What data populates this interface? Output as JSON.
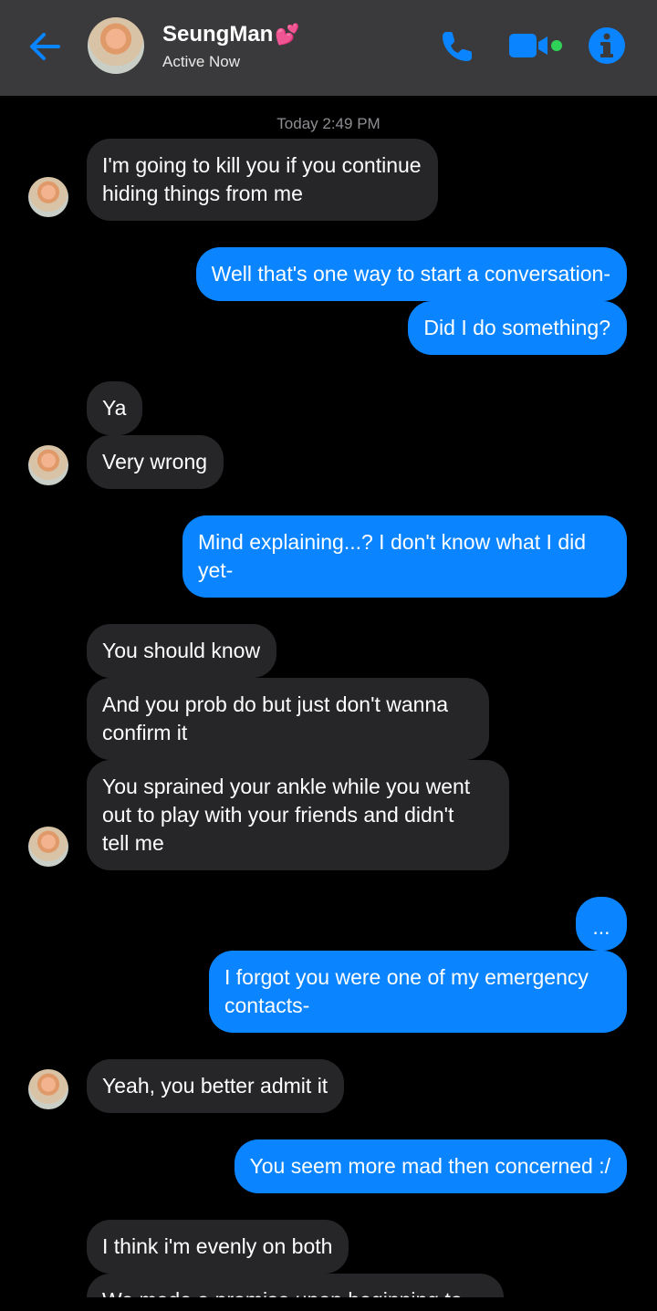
{
  "header": {
    "contact_name": "SeungMan",
    "name_emoji": "💕",
    "status": "Active Now",
    "icons": [
      "back-arrow-icon",
      "phone-icon",
      "video-icon",
      "info-icon"
    ],
    "accent_color": "#0a84ff",
    "online_dot_color": "#30d158"
  },
  "conversation": {
    "timestamp": "Today 2:49 PM",
    "messages": [
      {
        "from": "them",
        "text_lines": [
          "I'm going to kill you if you continue",
          "hiding things from me"
        ]
      },
      {
        "from": "me",
        "text_lines": [
          "Well that's one way to start a conversation-"
        ]
      },
      {
        "from": "me",
        "text_lines": [
          "Did I do something?"
        ]
      },
      {
        "from": "them",
        "text_lines": [
          "Ya"
        ]
      },
      {
        "from": "them",
        "text_lines": [
          "Very wrong"
        ]
      },
      {
        "from": "me",
        "text_lines": [
          "Mind explaining...? I don't know what I did",
          "yet-"
        ]
      },
      {
        "from": "them",
        "text_lines": [
          "You should know"
        ]
      },
      {
        "from": "them",
        "text_lines": [
          "And you prob do but just don't wanna",
          "confirm it"
        ]
      },
      {
        "from": "them",
        "text_lines": [
          "You sprained your ankle while you went",
          "out to play with your friends and didn't",
          "tell me"
        ]
      },
      {
        "from": "me",
        "text_lines": [
          "..."
        ]
      },
      {
        "from": "me",
        "text_lines": [
          "I forgot you were one of my emergency",
          "contacts-"
        ]
      },
      {
        "from": "them",
        "text_lines": [
          "Yeah, you better admit it"
        ]
      },
      {
        "from": "me",
        "text_lines": [
          "You seem more mad then concerned :/"
        ]
      },
      {
        "from": "them",
        "text_lines": [
          "I think i'm evenly on both"
        ]
      },
      {
        "from": "them",
        "text_lines": [
          "We made a promise upon beginning to"
        ]
      }
    ]
  },
  "colors": {
    "incoming_bubble": "#262629",
    "outgoing_bubble": "#0a84ff",
    "header_bg": "#3a3a3c",
    "background": "#000000"
  }
}
